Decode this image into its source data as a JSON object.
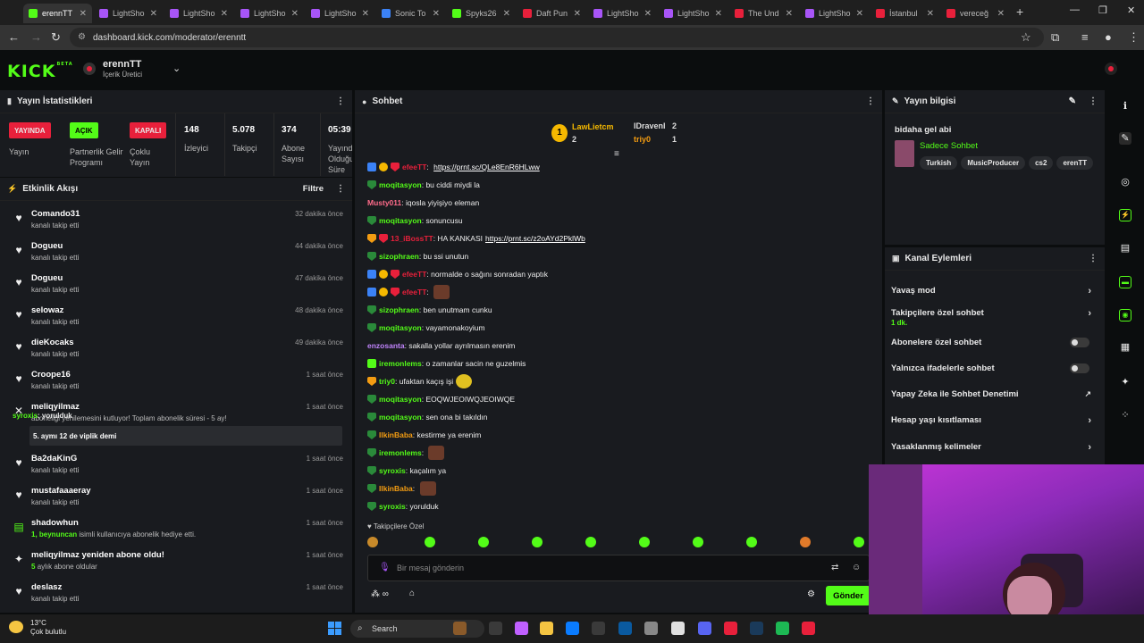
{
  "browser": {
    "tabs": [
      {
        "title": "erennTT",
        "color": "#53fc18",
        "active": true
      },
      {
        "title": "LightSho",
        "color": "#a855f7"
      },
      {
        "title": "LightSho",
        "color": "#a855f7"
      },
      {
        "title": "LightSho",
        "color": "#a855f7"
      },
      {
        "title": "LightSho",
        "color": "#a855f7"
      },
      {
        "title": "Sonic To",
        "color": "#3b82f6"
      },
      {
        "title": "Spyks26",
        "color": "#53fc18"
      },
      {
        "title": "Daft Pun",
        "color": "#e8203b"
      },
      {
        "title": "LightSho",
        "color": "#a855f7"
      },
      {
        "title": "LightSho",
        "color": "#a855f7"
      },
      {
        "title": "The Und",
        "color": "#e8203b"
      },
      {
        "title": "LightSho",
        "color": "#a855f7"
      },
      {
        "title": "İstanbul",
        "color": "#e8203b"
      },
      {
        "title": "vereceğ",
        "color": "#e8203b"
      }
    ],
    "new_tab": "+",
    "url": "dashboard.kick.com/moderator/erenntt"
  },
  "header": {
    "logo": "KICK",
    "logo_beta": "BETA",
    "channel_name": "erennTT",
    "channel_role": "İçerik Üretici"
  },
  "stats": {
    "title": "Yayın İstatistikleri",
    "yayinda_badge": "YAYINDA",
    "yayin_label": "Yayın",
    "acik_badge": "AÇIK",
    "partner_label": "Partnerlik Gelir Programı",
    "kapali_badge": "KAPALI",
    "coklu_label": "Çoklu Yayın",
    "viewers": "148",
    "viewers_label": "İzleyici",
    "followers": "5.078",
    "followers_label": "Takipçi",
    "subs": "374",
    "subs_label": "Abone Sayısı",
    "uptime": "05:39",
    "uptime_label": "Yayında Olduğu Süre"
  },
  "activity": {
    "title": "Etkinlik Akışı",
    "filter": "Filtre",
    "items": [
      {
        "name": "Comando31",
        "desc": "kanalı takip etti",
        "time": "32 dakika önce"
      },
      {
        "name": "Dogueu",
        "desc": "kanalı takip etti",
        "time": "44 dakika önce"
      },
      {
        "name": "Dogueu",
        "desc": "kanalı takip etti",
        "time": "47 dakika önce"
      },
      {
        "name": "selowaz",
        "desc": "kanalı takip etti",
        "time": "48 dakika önce"
      },
      {
        "name": "dieKocaks",
        "desc": "kanalı takip etti",
        "time": "49 dakika önce"
      },
      {
        "name": "Croope16",
        "desc": "kanalı takip etti",
        "time": "1 saat önce"
      },
      {
        "name": "meliqyilmaz",
        "desc": "aboneliği yenilemesini kutluyor! Toplam abonelik süresi - 5 ay!",
        "time": "1 saat önce"
      },
      {
        "name": "Ba2daKinG",
        "desc": "kanalı takip etti",
        "time": "1 saat önce"
      },
      {
        "name": "mustafaaaeray",
        "desc": "kanalı takip etti",
        "time": "1 saat önce"
      },
      {
        "name": "shadowhun",
        "desc_highlight": "1, beynuncan",
        "desc": "isimli kullanıcıya abonelik hediye etti.",
        "time": "1 saat önce"
      },
      {
        "name": "meliqyilmaz yeniden abone oldu!",
        "desc_highlight": "5",
        "desc": "aylık abone oldular",
        "time": "1 saat önce"
      },
      {
        "name": "deslasz",
        "desc": "kanalı takip etti",
        "time": "1 saat önce"
      }
    ],
    "sub_message": "5. aymı 12 de viplik demi",
    "overlay_user": "syroxis",
    "overlay_text": ": yorulduk"
  },
  "chat": {
    "title": "Sohbet",
    "podium": [
      {
        "name": "LawLietcm",
        "count": "2"
      },
      {
        "name": "IDravenI",
        "count": "2"
      },
      {
        "name": "triy0",
        "count": "1"
      }
    ],
    "messages": [
      {
        "user": "efeeTT",
        "color": "#e8203b",
        "badges": [
          "blue",
          "gold",
          "vip"
        ],
        "text": "",
        "link": "https://prnt.sc/QLe8EnR6HLww"
      },
      {
        "user": "moqitasyon",
        "color": "#53fc18",
        "badges": [
          "mod"
        ],
        "text": "bu ciddi miydi la"
      },
      {
        "user": "Musty011",
        "color": "#ff6b8a",
        "badges": [],
        "text": "iqosla yiyişiyo eleman"
      },
      {
        "user": "moqitasyon",
        "color": "#53fc18",
        "badges": [
          "mod"
        ],
        "text": "sonuncusu"
      },
      {
        "user": "13_iBossTT",
        "color": "#e8203b",
        "badges": [
          "og",
          "vip"
        ],
        "text": "HA KANKASI",
        "link": "https://prnt.sc/z2oAYd2PklWb"
      },
      {
        "user": "sizophraen",
        "color": "#53fc18",
        "badges": [
          "mod"
        ],
        "text": "bu ssi unutun"
      },
      {
        "user": "efeeTT",
        "color": "#e8203b",
        "badges": [
          "blue",
          "gold",
          "vip"
        ],
        "text": "normalde o sağını sonradan yaptık"
      },
      {
        "user": "efeeTT",
        "color": "#e8203b",
        "badges": [
          "blue",
          "gold",
          "vip"
        ],
        "text": "",
        "emote": "brown"
      },
      {
        "user": "sizophraen",
        "color": "#53fc18",
        "badges": [
          "mod"
        ],
        "text": "ben unutmam cunku"
      },
      {
        "user": "moqitasyon",
        "color": "#53fc18",
        "badges": [
          "mod"
        ],
        "text": "vayamonakoyium"
      },
      {
        "user": "enzosanta",
        "color": "#c084fc",
        "badges": [],
        "text": "sakalla yollar ayrılmasın erenim"
      },
      {
        "user": "iremonlems",
        "color": "#53fc18",
        "badges": [
          "green"
        ],
        "text": "o zamanlar sacin ne guzelmis"
      },
      {
        "user": "triy0",
        "color": "#53fc18",
        "badges": [
          "og"
        ],
        "text": "ufaktan kaçış işi",
        "emote": "yellow"
      },
      {
        "user": "moqitasyon",
        "color": "#53fc18",
        "badges": [
          "mod"
        ],
        "text": "EOQWJEOIWQJEOIWQE"
      },
      {
        "user": "moqitasyon",
        "color": "#53fc18",
        "badges": [
          "mod"
        ],
        "text": "sen ona bi takıldın"
      },
      {
        "user": "IlkinBaba",
        "color": "#f39c12",
        "badges": [
          "mod"
        ],
        "text": "kestirme ya erenim"
      },
      {
        "user": "iremonlems",
        "color": "#53fc18",
        "badges": [
          "mod"
        ],
        "text": "",
        "emote": "brown"
      },
      {
        "user": "syroxis",
        "color": "#53fc18",
        "badges": [
          "mod"
        ],
        "text": "kaçalım ya"
      },
      {
        "user": "IlkinBaba",
        "color": "#f39c12",
        "badges": [
          "mod"
        ],
        "text": "",
        "emote": "brown"
      },
      {
        "user": "syroxis",
        "color": "#53fc18",
        "badges": [
          "mod"
        ],
        "text": "yorulduk"
      }
    ],
    "followers_only": "Takipçilere Özel",
    "input_placeholder": "Bir mesaj gönderin",
    "send": "Gönder"
  },
  "info": {
    "title": "Yayın bilgisi",
    "stream_title": "bidaha gel abi",
    "category": "Sadece Sohbet",
    "tags": [
      "Turkish",
      "MusicProducer",
      "cs2",
      "erenTT"
    ]
  },
  "actions": {
    "title": "Kanal Eylemleri",
    "items": [
      {
        "label": "Yavaş mod",
        "type": "chevron"
      },
      {
        "label": "Takipçilere özel sohbet",
        "sub": "1 dk.",
        "type": "chevron"
      },
      {
        "label": "Abonelere özel sohbet",
        "type": "toggle"
      },
      {
        "label": "Yalnızca ifadelerle sohbet",
        "type": "toggle"
      },
      {
        "label": "Yapay Zeka ile Sohbet Denetimi",
        "type": "external"
      },
      {
        "label": "Hesap yaşı kısıtlaması",
        "type": "chevron"
      },
      {
        "label": "Yasaklanmış kelimeler",
        "type": "chevron"
      }
    ]
  },
  "taskbar": {
    "temp": "13°C",
    "weather": "Çok bulutlu",
    "search": "Search"
  }
}
